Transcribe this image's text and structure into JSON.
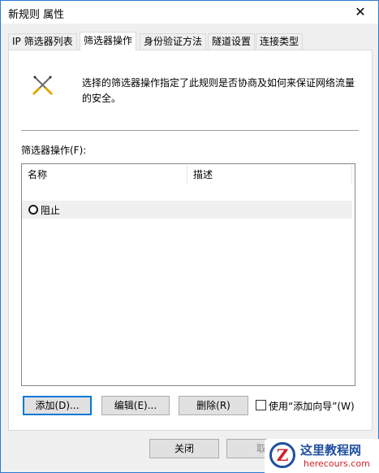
{
  "window": {
    "title": "新规则 属性",
    "close_glyph": "✕"
  },
  "tabs": [
    {
      "label": "IP 筛选器列表"
    },
    {
      "label": "筛选器操作"
    },
    {
      "label": "身份验证方法"
    },
    {
      "label": "隧道设置"
    },
    {
      "label": "连接类型"
    }
  ],
  "active_tab_index": 1,
  "panel": {
    "icon": "filter-action-tool-icon",
    "description": "选择的筛选器操作指定了此规则是否协商及如何来保证网络流量的安全。",
    "list_label": "筛选器操作(F):",
    "columns": [
      "名称",
      "描述"
    ],
    "rows": [
      {
        "name": "阻止",
        "description": "",
        "selected": true
      }
    ]
  },
  "buttons": {
    "add": "添加(D)...",
    "edit": "编辑(E)...",
    "delete": "删除(R)",
    "close": "关闭",
    "cancel": "取"
  },
  "wizard_checkbox": {
    "label": "使用“添加向导”(W)",
    "checked": false
  },
  "watermark": {
    "logo_letter": "Z",
    "title": "这里教程网",
    "url": "herecours.com"
  },
  "colors": {
    "accent": "#0078d7",
    "window_border": "#2b7cd3",
    "row_highlight": "#f0f0f0"
  }
}
